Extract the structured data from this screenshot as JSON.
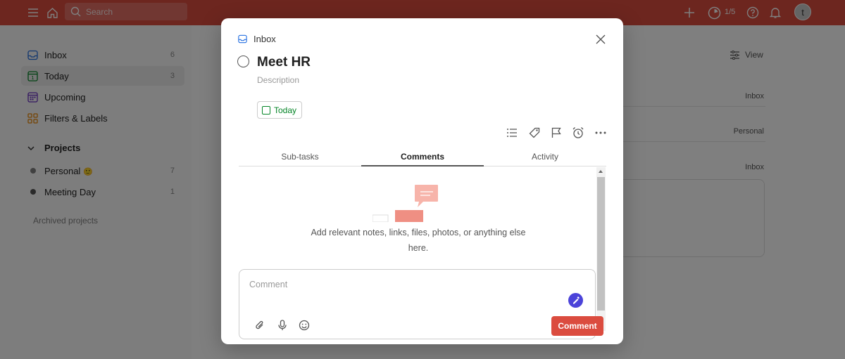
{
  "topbar": {
    "search_placeholder": "Search",
    "karma": "1/5",
    "avatar_initial": "t"
  },
  "sidebar": {
    "items": [
      {
        "label": "Inbox",
        "count": "6"
      },
      {
        "label": "Today",
        "count": "3"
      },
      {
        "label": "Upcoming",
        "count": ""
      },
      {
        "label": "Filters & Labels",
        "count": ""
      }
    ],
    "projects_heading": "Projects",
    "projects": [
      {
        "label": "Personal",
        "count": "7",
        "emoji": "🙂"
      },
      {
        "label": "Meeting Day",
        "count": "1",
        "emoji": ""
      }
    ],
    "archived_label": "Archived projects"
  },
  "main": {
    "view_label": "View",
    "rows": [
      {
        "project": "Inbox"
      },
      {
        "project": "Personal"
      },
      {
        "project": "Inbox"
      }
    ]
  },
  "modal": {
    "breadcrumb": "Inbox",
    "task_title": "Meet HR",
    "description_placeholder": "Description",
    "date_label": "Today",
    "tabs": [
      "Sub-tasks",
      "Comments",
      "Activity"
    ],
    "empty_text": "Add relevant notes, links, files, photos, or anything else here.",
    "comment_placeholder": "Comment",
    "comment_button": "Comment"
  },
  "colors": {
    "brand": "#db4c3f",
    "today_green": "#058527",
    "grammar_purple": "#4b43d9"
  }
}
